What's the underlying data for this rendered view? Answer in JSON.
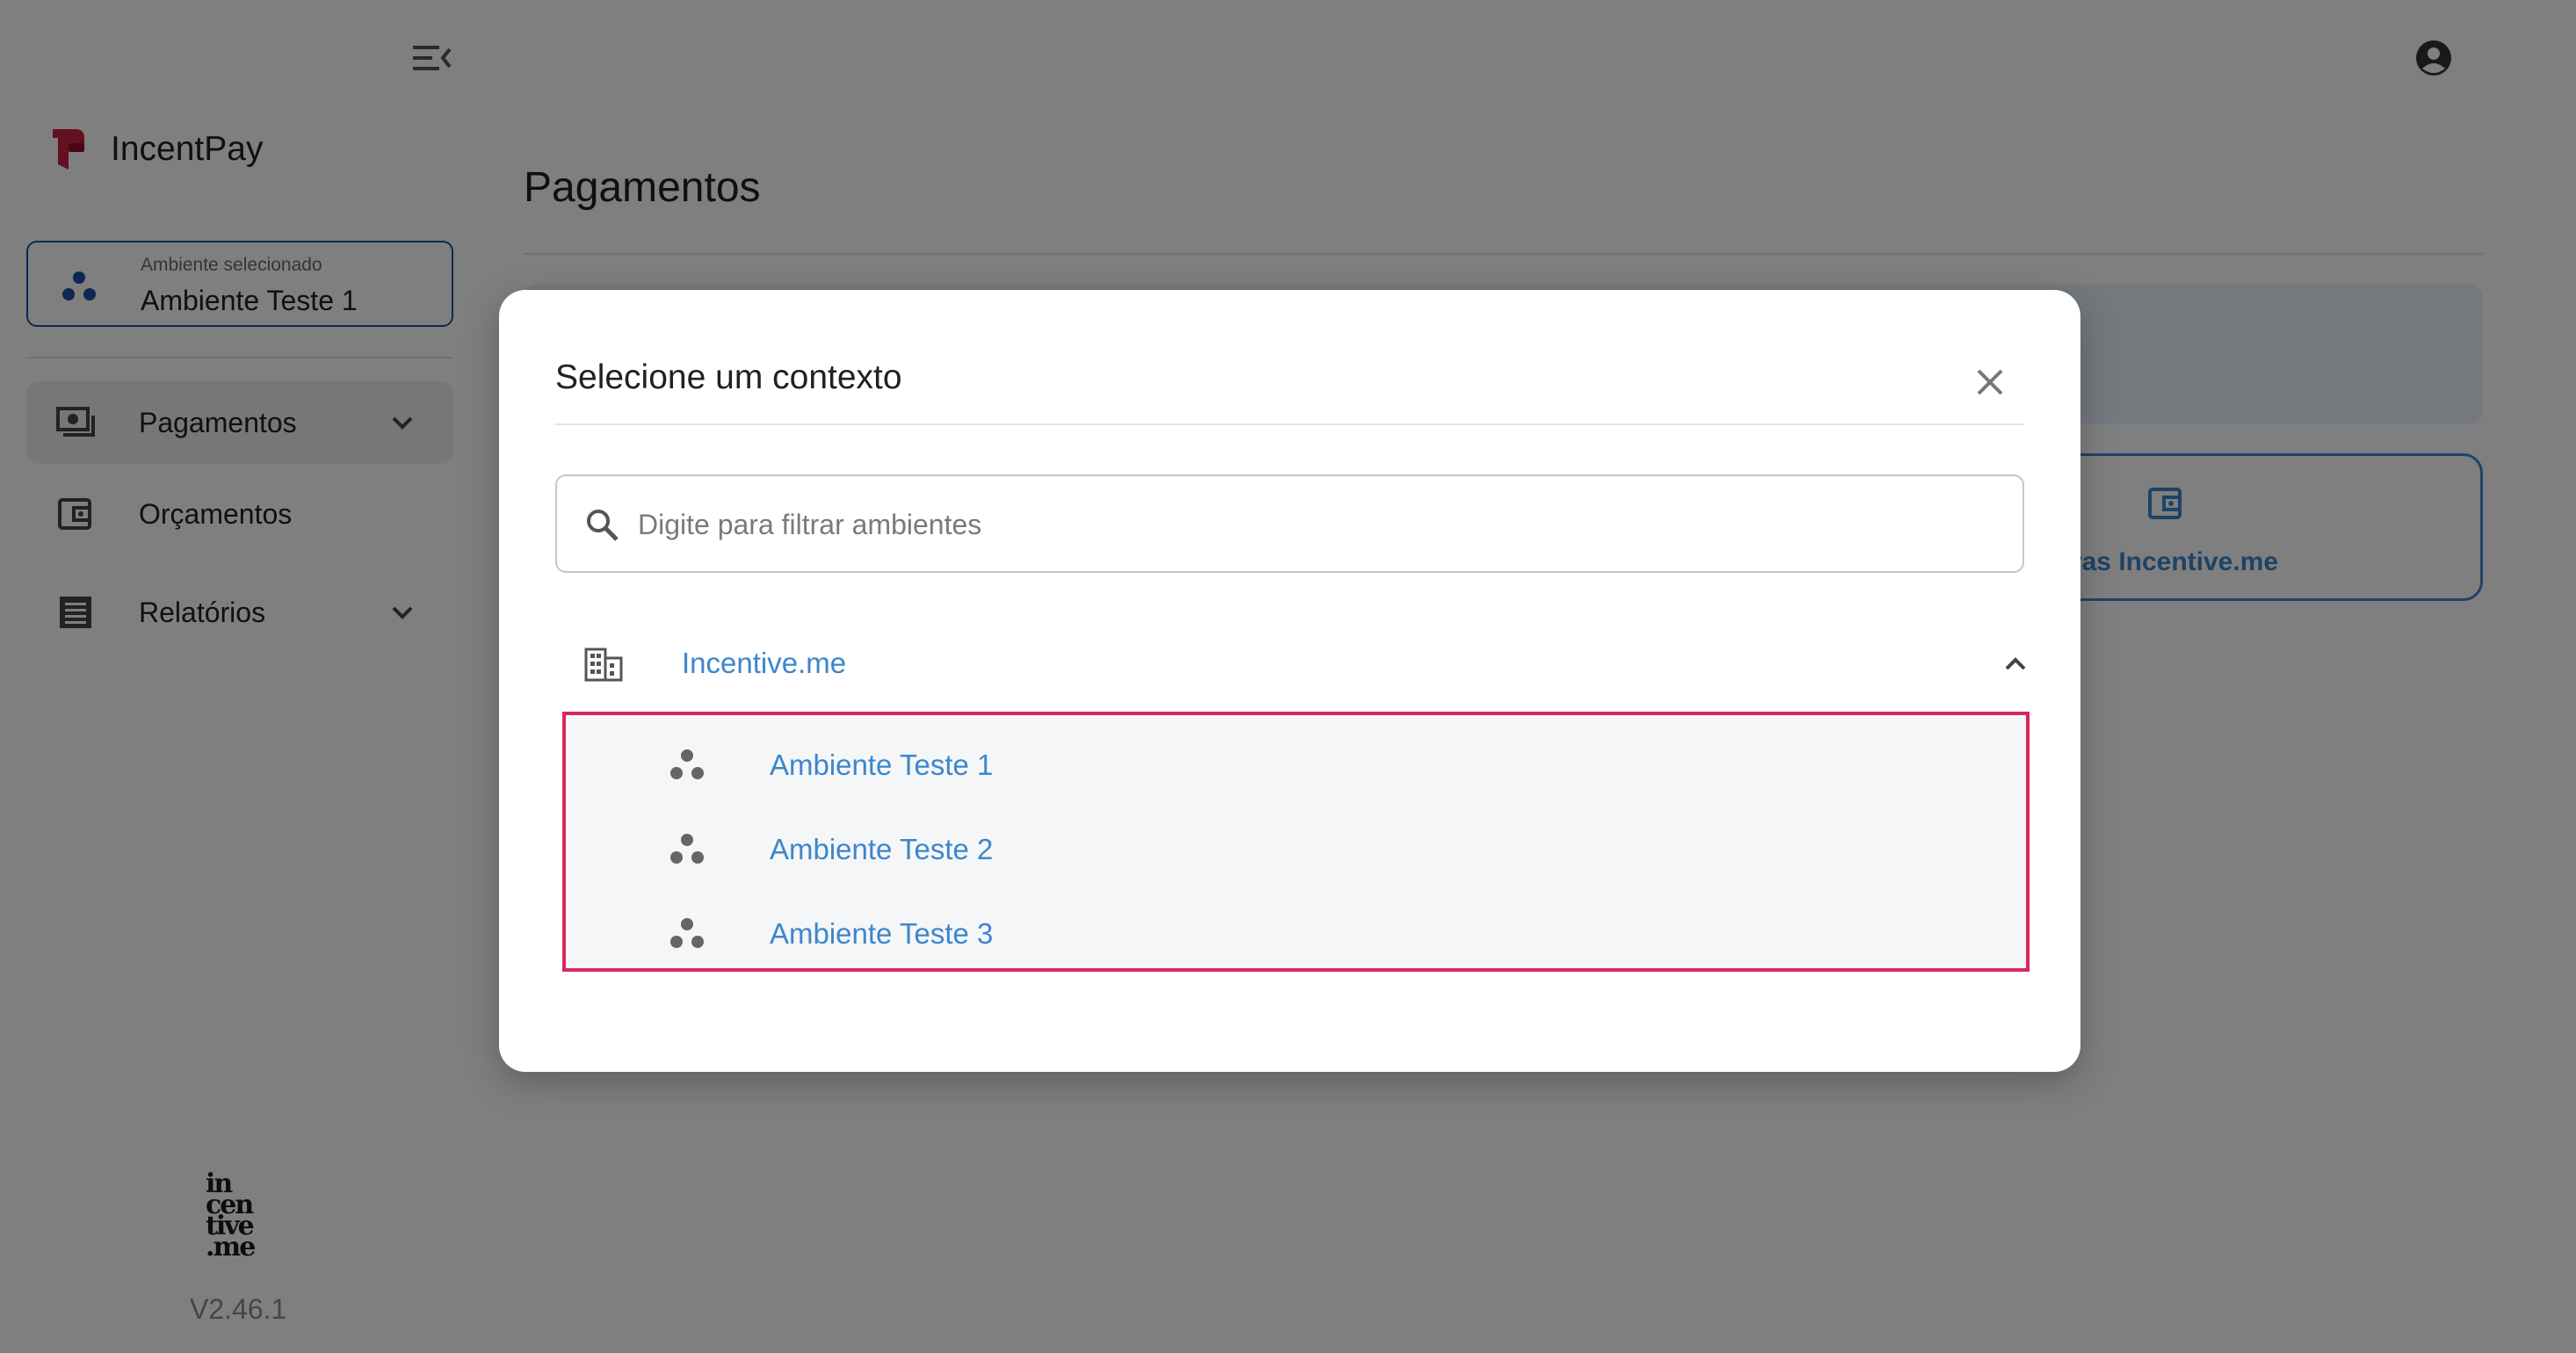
{
  "app": {
    "name": "IncentPay",
    "brand_color": "#c8203f"
  },
  "sidebar": {
    "collapse_icon": "menu-collapse-icon",
    "environment_selector": {
      "caption": "Ambiente selecionado",
      "value": "Ambiente Teste 1",
      "icon": "environment-icon"
    },
    "nav": [
      {
        "label": "Pagamentos",
        "icon": "payments-icon",
        "has_submenu": true,
        "active": true
      },
      {
        "label": "Orçamentos",
        "icon": "wallet-icon",
        "has_submenu": false,
        "active": false
      },
      {
        "label": "Relatórios",
        "icon": "report-icon",
        "has_submenu": true,
        "active": false
      }
    ],
    "footer_logo": [
      "in",
      "cen",
      "tive",
      ".me"
    ],
    "version": "V2.46.1"
  },
  "header": {
    "avatar_icon": "account-circle-icon"
  },
  "main": {
    "title": "Pagamentos",
    "wallet_card_label": "eiras Incentive.me"
  },
  "dialog": {
    "title": "Selecione um contexto",
    "close_icon": "close-icon",
    "search": {
      "placeholder": "Digite para filtrar ambientes",
      "value": ""
    },
    "organization": {
      "label": "Incentive.me",
      "icon": "building-icon",
      "expanded": true
    },
    "environments": [
      {
        "label": "Ambiente Teste 1"
      },
      {
        "label": "Ambiente Teste 2"
      },
      {
        "label": "Ambiente Teste 3"
      }
    ],
    "highlight_color": "#d8285a",
    "link_color": "#3d86cc"
  }
}
